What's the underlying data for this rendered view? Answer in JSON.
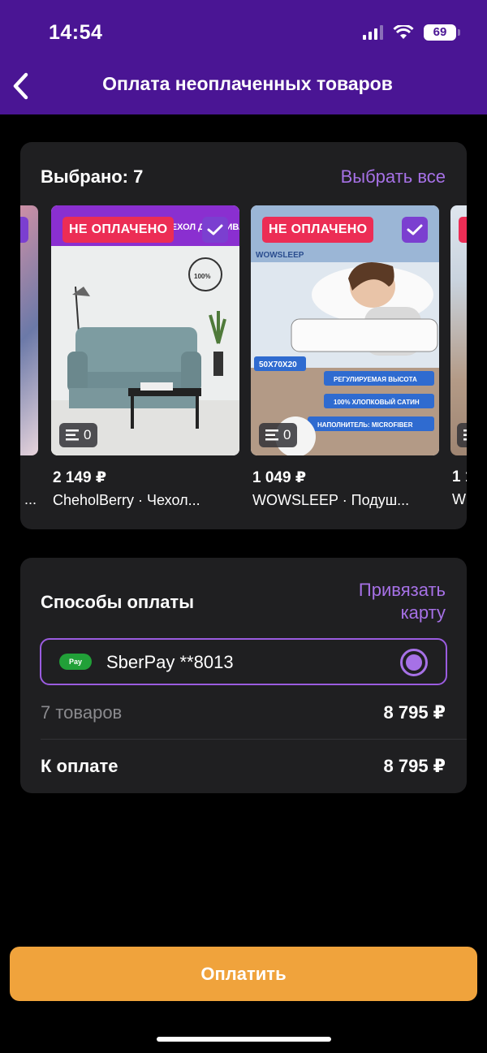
{
  "status_bar": {
    "time": "14:54",
    "battery": "69"
  },
  "header": {
    "title": "Оплата неоплаченных товаров"
  },
  "selection": {
    "selected_label": "Выбрано: 7",
    "select_all": "Выбрать все"
  },
  "products": [
    {
      "badge": "НЕ ОПЛАЧЕНО",
      "count": "0",
      "price": "2 149 ₽",
      "name": "CheholBerry · Чехол...",
      "thumb_text": "ЧЕХОЛ ДЛЯ ДИВАНА"
    },
    {
      "badge": "НЕ ОПЛАЧЕНО",
      "count": "0",
      "price": "1 049 ₽",
      "name": "WOWSLEEP · Подуш...",
      "thumb_brand": "WOWSLEEP",
      "thumb_size": "50X70X20",
      "thumb_f1": "РЕГУЛИРУЕМАЯ ВЫСОТА",
      "thumb_f2": "100% ХЛОПКОВЫЙ САТИН",
      "thumb_f3": "НАПОЛНИТЕЛЬ: MICROFIBER"
    }
  ],
  "partial": {
    "left_price_tail": "...",
    "right_price": "1 1",
    "right_name": "W"
  },
  "payment": {
    "title": "Способы оплаты",
    "bind_card": "Привязать карту",
    "method_logo": "Pay",
    "method": "SberPay **8013",
    "items_label": "7 товаров",
    "items_total": "8 795 ₽",
    "due_label": "К оплате",
    "due_total": "8 795 ₽"
  },
  "pay_button": "Оплатить",
  "colors": {
    "header": "#4a1594",
    "accent": "#a671e6",
    "badge": "#ec2d55",
    "button": "#f0a33c"
  }
}
